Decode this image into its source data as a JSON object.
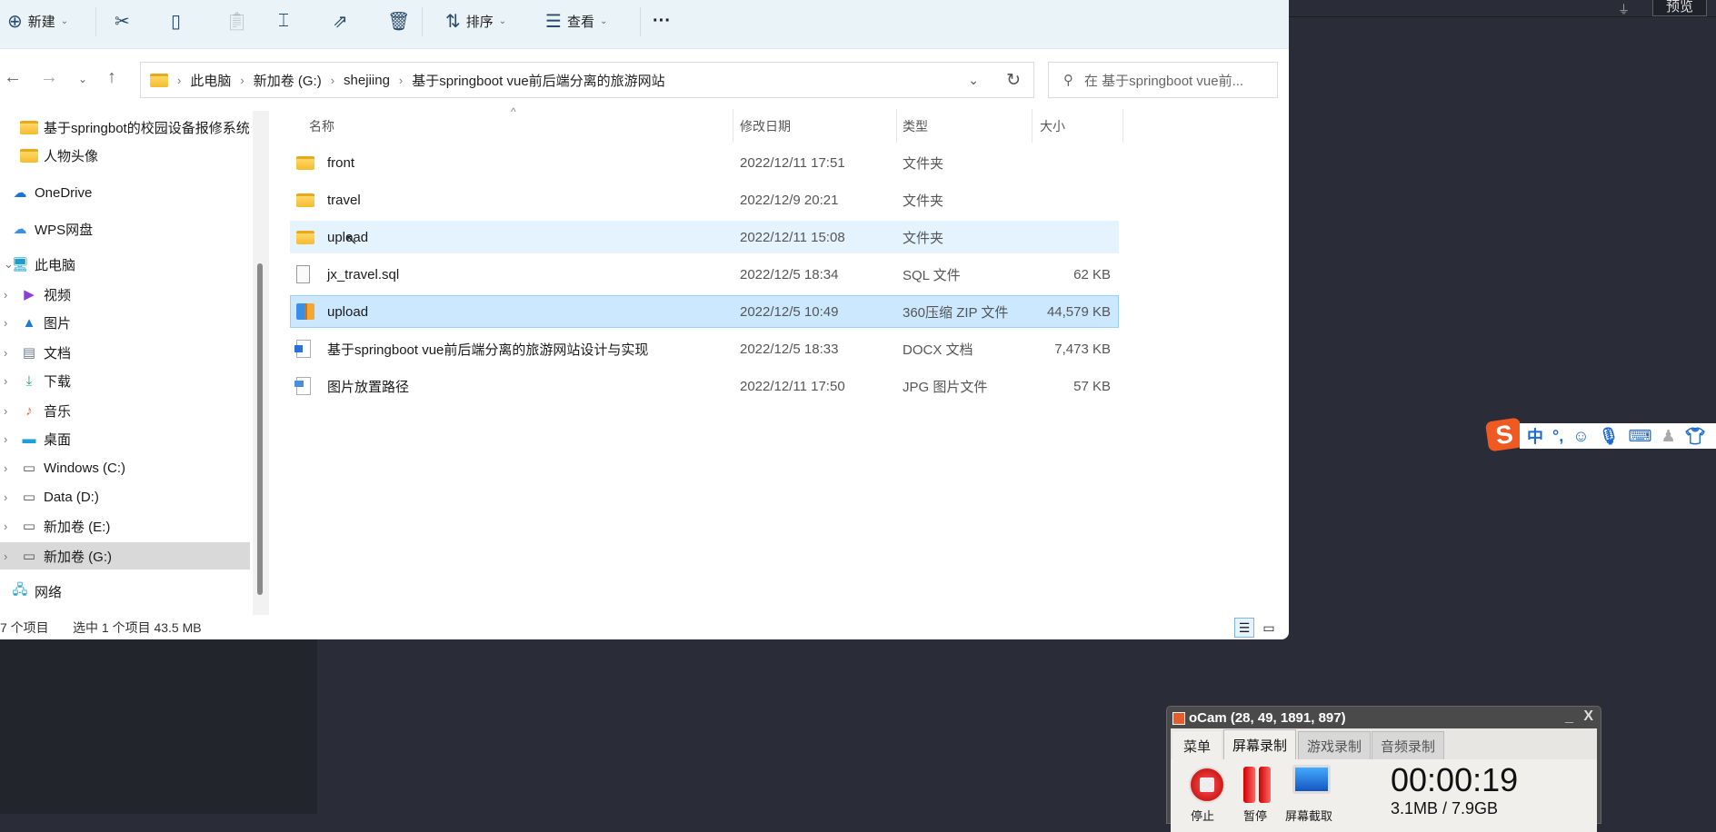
{
  "toolbar": {
    "new": "新建",
    "sort": "排序",
    "view": "查看",
    "more": "···"
  },
  "address": {
    "crumbs": [
      "此电脑",
      "新加卷 (G:)",
      "shejiing",
      "基于springboot vue前后端分离的旅游网站"
    ]
  },
  "search": {
    "placeholder": "在 基于springboot vue前..."
  },
  "sidebar": {
    "items": [
      {
        "label": "基于springbot的校园设备报修系统"
      },
      {
        "label": "人物头像"
      },
      {
        "label": "OneDrive"
      },
      {
        "label": "WPS网盘"
      },
      {
        "label": "此电脑"
      },
      {
        "label": "视频"
      },
      {
        "label": "图片"
      },
      {
        "label": "文档"
      },
      {
        "label": "下载"
      },
      {
        "label": "音乐"
      },
      {
        "label": "桌面"
      },
      {
        "label": "Windows (C:)"
      },
      {
        "label": "Data (D:)"
      },
      {
        "label": "新加卷 (E:)"
      },
      {
        "label": "新加卷 (G:)"
      },
      {
        "label": "网络"
      }
    ]
  },
  "columns": {
    "name": "名称",
    "date": "修改日期",
    "type": "类型",
    "size": "大小"
  },
  "files": [
    {
      "name": "front",
      "date": "2022/12/11 17:51",
      "type": "文件夹",
      "size": ""
    },
    {
      "name": "travel",
      "date": "2022/12/9 20:21",
      "type": "文件夹",
      "size": ""
    },
    {
      "name": "upload",
      "date": "2022/12/11 15:08",
      "type": "文件夹",
      "size": ""
    },
    {
      "name": "jx_travel.sql",
      "date": "2022/12/5 18:34",
      "type": "SQL 文件",
      "size": "62 KB"
    },
    {
      "name": "upload",
      "date": "2022/12/5 10:49",
      "type": "360压缩 ZIP 文件",
      "size": "44,579 KB"
    },
    {
      "name": "基于springboot vue前后端分离的旅游网站设计与实现",
      "date": "2022/12/5 18:33",
      "type": "DOCX 文档",
      "size": "7,473 KB"
    },
    {
      "name": "图片放置路径",
      "date": "2022/12/11 17:50",
      "type": "JPG 图片文件",
      "size": "57 KB"
    }
  ],
  "status": {
    "count": "7 个项目",
    "selection": "选中 1 个项目  43.5 MB"
  },
  "background": {
    "preview_button": "预览"
  },
  "ime": {
    "mode": "中",
    "punct": "°,"
  },
  "ocam": {
    "title": "oCam (28, 49, 1891, 897)",
    "tabs": [
      "菜单",
      "屏幕录制",
      "游戏录制",
      "音频录制"
    ],
    "timer": "00:00:19",
    "size": "3.1MB / 7.9GB",
    "buttons": [
      "停止",
      "暂停",
      "屏幕截取"
    ]
  }
}
